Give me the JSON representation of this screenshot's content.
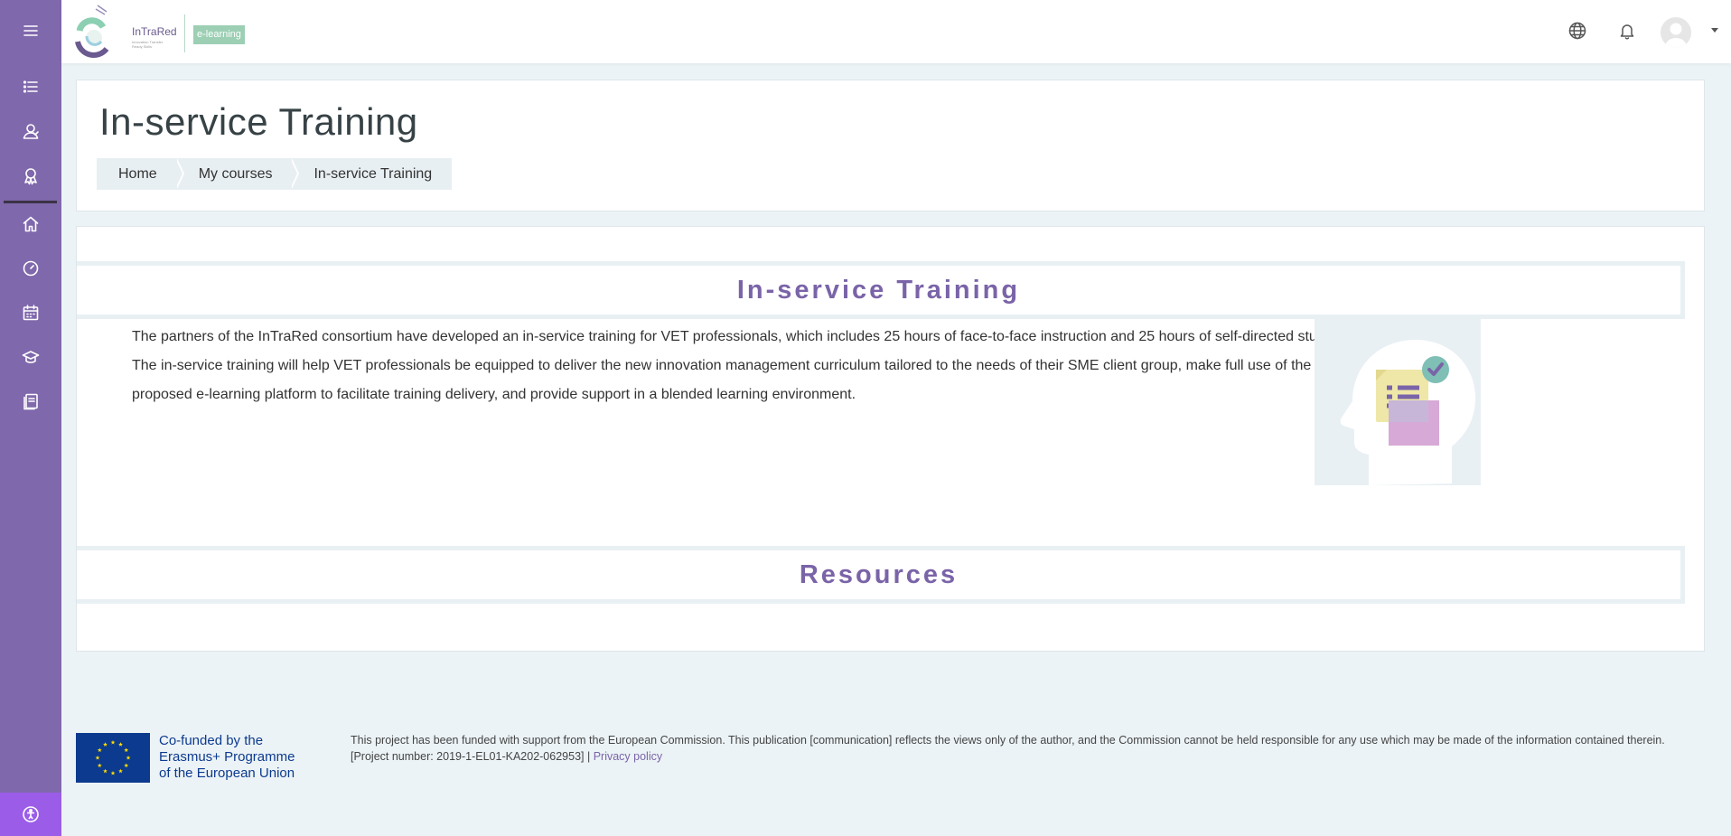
{
  "brand": {
    "logo_name": "InTraRed",
    "logo_sub": "Innovation Transfer Ready Skills",
    "badge": "e-learning"
  },
  "sidebar": {
    "items": [
      {
        "icon": "list-icon"
      },
      {
        "icon": "participants-icon"
      },
      {
        "icon": "badges-icon"
      },
      {
        "icon": "home-icon"
      },
      {
        "icon": "dashboard-icon"
      },
      {
        "icon": "calendar-icon"
      },
      {
        "icon": "courses-icon"
      },
      {
        "icon": "content-bank-icon"
      }
    ],
    "accessibility_icon": "accessibility-icon"
  },
  "header": {
    "title": "In-service Training",
    "breadcrumb": [
      "Home",
      "My courses",
      "In-service Training"
    ]
  },
  "content": {
    "section1_title": "In-service Training",
    "intro": "The partners of the InTraRed consortium have developed an in-service training for VET professionals, which includes 25 hours of face-to-face instruction and 25 hours of self-directed study. The in-service training will help VET professionals be equipped to deliver the new innovation management curriculum tailored to the needs of their SME client group, make full use of the proposed e-learning platform to facilitate training delivery, and provide support in a blended learning environment.",
    "section2_title": "Resources"
  },
  "footer": {
    "eu_line1": "Co-funded by the",
    "eu_line2": "Erasmus+ Programme",
    "eu_line3": "of the European Union",
    "disclaimer": "This project has been funded with support from the European Commission. This publication [communication] reflects the views only of the author, and the Commission cannot be held responsible for any use which may be made of the information contained therein. [Project number: 2019-1-EL01-KA202-062953] |",
    "privacy_link": "Privacy policy"
  },
  "colors": {
    "sidebar": "#8068ac",
    "accent": "#7a64a8",
    "accessibility": "#9b5de8",
    "background": "#ecf3f6"
  }
}
